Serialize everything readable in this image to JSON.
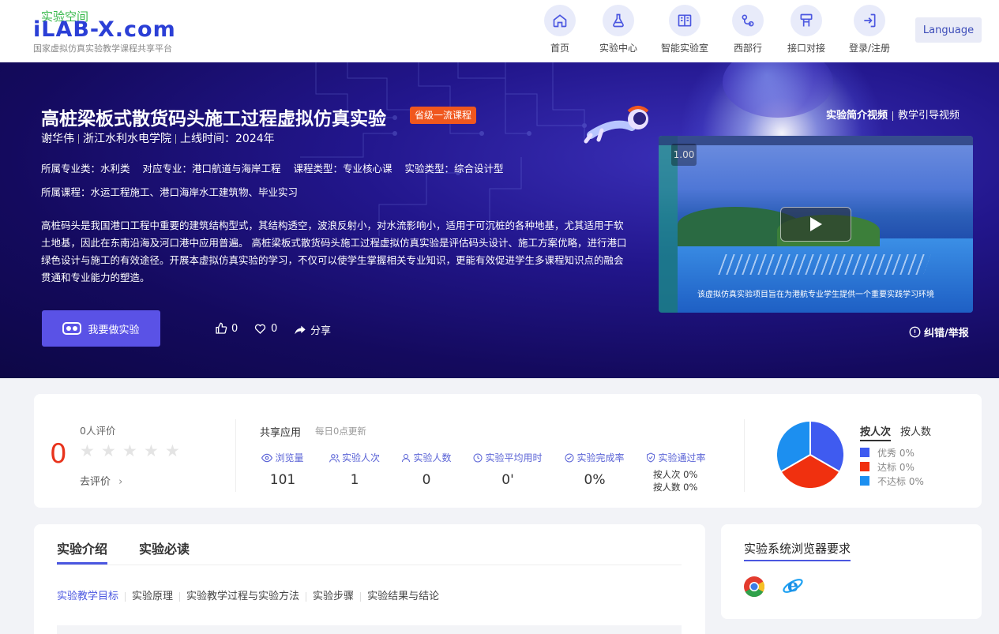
{
  "header": {
    "logo_cn": "实验空间",
    "logo_en": "iLAB-X.com",
    "logo_sub": "国家虚拟仿真实验教学课程共享平台",
    "nav": [
      {
        "label": "首页",
        "icon": "home-icon"
      },
      {
        "label": "实验中心",
        "icon": "flask-icon"
      },
      {
        "label": "智能实验室",
        "icon": "book-icon"
      },
      {
        "label": "西部行",
        "icon": "route-icon"
      },
      {
        "label": "接口对接",
        "icon": "interface-icon"
      },
      {
        "label": "登录/注册",
        "icon": "login-icon"
      }
    ],
    "language": "Language"
  },
  "banner": {
    "title": "高桩梁板式散货码头施工过程虚拟仿真实验",
    "badge": "省级一流课程",
    "author": "谢华伟",
    "school": "浙江水利水电学院",
    "online": "上线时间：2024年",
    "info1": [
      "所属专业类：水利类",
      "对应专业：港口航道与海岸工程",
      "课程类型：专业核心课",
      "实验类型：综合设计型"
    ],
    "info2": "所属课程：水运工程施工、港口海岸水工建筑物、毕业实习",
    "description": "高桩码头是我国港口工程中重要的建筑结构型式，其结构透空，波浪反射小，对水流影响小，适用于可沉桩的各种地基，尤其适用于软土地基，因此在东南沿海及河口港中应用普遍。 高桩梁板式散货码头施工过程虚拟仿真实验是评估码头设计、施工方案优略，进行港口绿色设计与施工的有效途径。开展本虚拟仿真实验的学习，不仅可以使学生掌握相关专业知识，更能有效促进学生多课程知识点的融会贯通和专业能力的塑造。",
    "do_button": "我要做实验",
    "likes": "0",
    "favorites": "0",
    "share": "分享",
    "video_tabs": [
      "实验简介视频",
      "教学引导视频"
    ],
    "video_speed": "1.00",
    "video_subtitle": "该虚拟仿真实验项目旨在为港航专业学生提供一个重要实践学习环境",
    "report": "纠错/举报"
  },
  "stats": {
    "score": "0",
    "eval_count": "0人评价",
    "go_eval": "去评价",
    "share_title": "共享应用",
    "share_note": "每日0点更新",
    "metrics": [
      {
        "label": "浏览量",
        "value": "101",
        "icon": "eye-icon"
      },
      {
        "label": "实验人次",
        "value": "1",
        "icon": "users-icon"
      },
      {
        "label": "实验人数",
        "value": "0",
        "icon": "user-icon"
      },
      {
        "label": "实验平均用时",
        "value": "0'",
        "icon": "clock-icon"
      },
      {
        "label": "实验完成率",
        "value": "0%",
        "icon": "check-circle-icon"
      },
      {
        "label": "实验通过率",
        "value": "",
        "icon": "shield-icon"
      }
    ],
    "pass_by_times": "按人次 0%",
    "pass_by_people": "按人数 0%",
    "pie_tabs": [
      "按人次",
      "按人数"
    ],
    "legend": [
      {
        "label": "优秀 0%",
        "color": "#3f5bf0"
      },
      {
        "label": "达标 0%",
        "color": "#f0300f"
      },
      {
        "label": "不达标 0%",
        "color": "#1c8ff0"
      }
    ]
  },
  "intro": {
    "tabs": [
      "实验介绍",
      "实验必读"
    ],
    "subtabs": [
      "实验教学目标",
      "实验原理",
      "实验教学过程与实验方法",
      "实验步骤",
      "实验结果与结论"
    ]
  },
  "browser": {
    "title": "实验系统浏览器要求"
  }
}
